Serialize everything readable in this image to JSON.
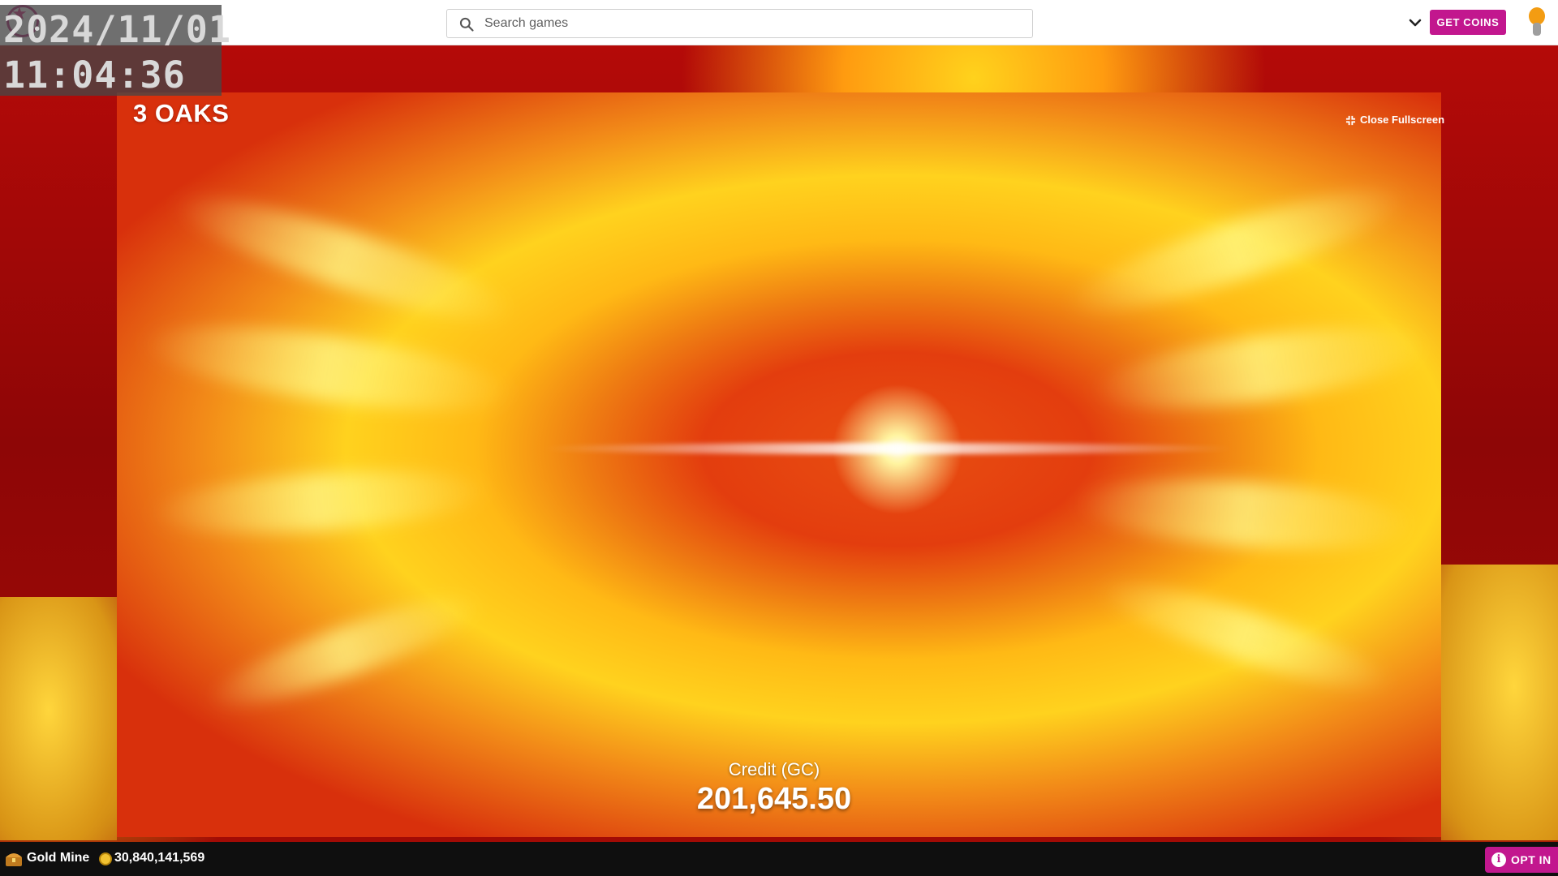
{
  "overlay": {
    "date": "2024/11/01",
    "time": "11:04:36"
  },
  "header": {
    "search": {
      "placeholder": "Search games"
    },
    "get_coins_label": "GET COINS"
  },
  "stage": {
    "close_fullscreen_label": "Close Fullscreen"
  },
  "game": {
    "provider": "3 OAKS",
    "credit_label": "Credit (GC)",
    "credit_value": "201,645.50"
  },
  "footer": {
    "mine_label": "Gold Mine",
    "balance": "30,840,141,569",
    "opt_in_label": "OPT IN"
  },
  "colors": {
    "accent": "#c2178e",
    "topbar": "#ffffff",
    "footer": "#0f0f0f",
    "stage": "#a20b05"
  },
  "icons": [
    "logo-icon",
    "search-icon",
    "chevron-down-icon",
    "lightbulb-icon",
    "collapse-icon",
    "chest-icon",
    "coin-icon",
    "info-icon"
  ]
}
